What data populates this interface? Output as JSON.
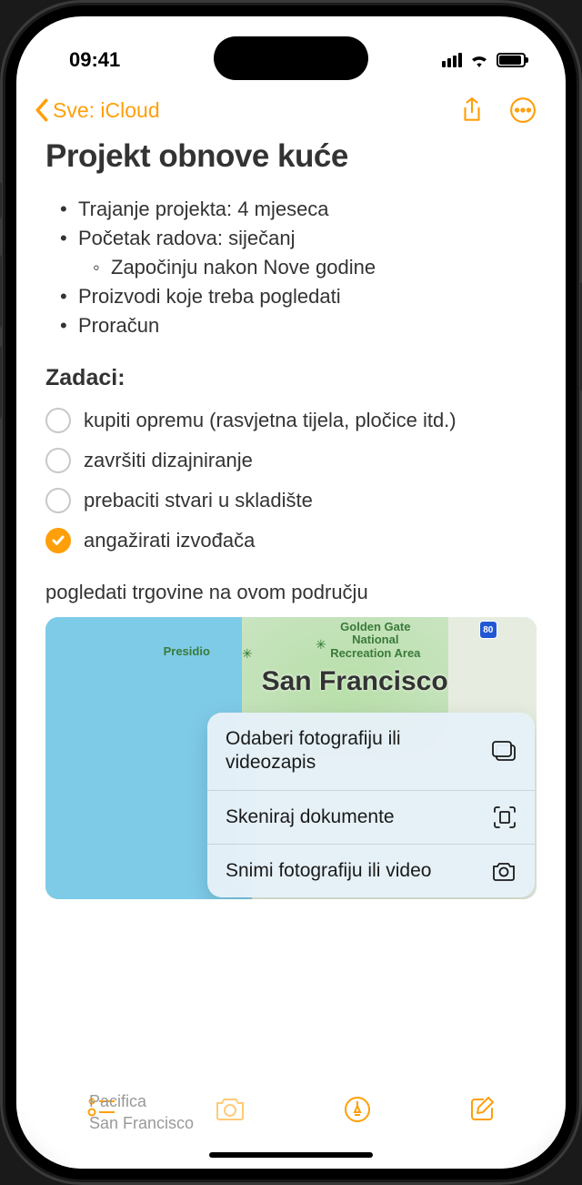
{
  "status": {
    "time": "09:41"
  },
  "nav": {
    "back_label": "Sve: iCloud"
  },
  "note": {
    "title": "Projekt obnove kuće",
    "bullets": {
      "0": "Trajanje projekta: 4 mjeseca",
      "1": "Početak radova: siječanj",
      "1_sub": "Započinju nakon Nove godine",
      "2": "Proizvodi koje treba pogledati",
      "3": "Proračun"
    },
    "tasks_heading": "Zadaci:",
    "tasks": {
      "0": {
        "text": "kupiti opremu (rasvjetna tijela, pločice itd.)",
        "checked": false
      },
      "1": {
        "text": "završiti dizajniranje",
        "checked": false
      },
      "2": {
        "text": "prebaciti stvari u skladište",
        "checked": false
      },
      "3": {
        "text": "angažirati izvođača",
        "checked": true
      }
    },
    "body_text": "pogledati trgovine na ovom području"
  },
  "map": {
    "city": "San Francisco",
    "park": "Golden Gate\nNational\nRecreation Area",
    "presidio": "Presidio",
    "road": "80",
    "faded_pacifica": "Pacifica",
    "faded_sf": "San Francisco"
  },
  "popup": {
    "items": {
      "0": "Odaberi fotografiju ili videozapis",
      "1": "Skeniraj dokumente",
      "2": "Snimi fotografiju ili video"
    }
  },
  "colors": {
    "accent": "#ff9f0a"
  }
}
